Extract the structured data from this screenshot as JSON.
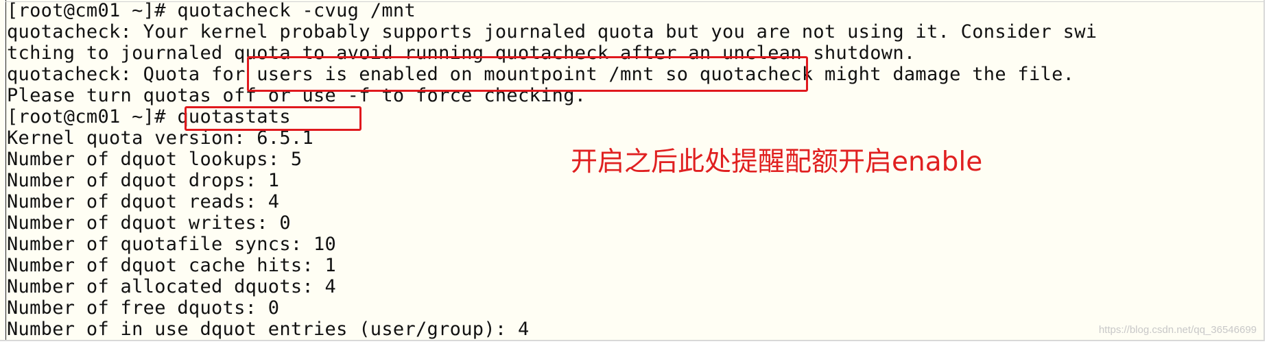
{
  "terminal": {
    "lines": [
      "[root@cm01 ~]# quotacheck -cvug /mnt",
      "quotacheck: Your kernel probably supports journaled quota but you are not using it. Consider swi",
      "tching to journaled quota to avoid running quotacheck after an unclean shutdown.",
      "quotacheck: Quota for users is enabled on mountpoint /mnt so quotacheck might damage the file.",
      "Please turn quotas off or use -f to force checking.",
      "[root@cm01 ~]# quotastats",
      "Kernel quota version: 6.5.1",
      "Number of dquot lookups: 5",
      "Number of dquot drops: 1",
      "Number of dquot reads: 4",
      "Number of dquot writes: 0",
      "Number of quotafile syncs: 10",
      "Number of dquot cache hits: 1",
      "Number of allocated dquots: 4",
      "Number of free dquots: 0",
      "Number of in use dquot entries (user/group): 4"
    ]
  },
  "annotation": {
    "text": "开启之后此处提醒配额开启enable",
    "color": "#e02020"
  },
  "watermark": {
    "text": "https://blog.csdn.net/qq_36546699"
  }
}
